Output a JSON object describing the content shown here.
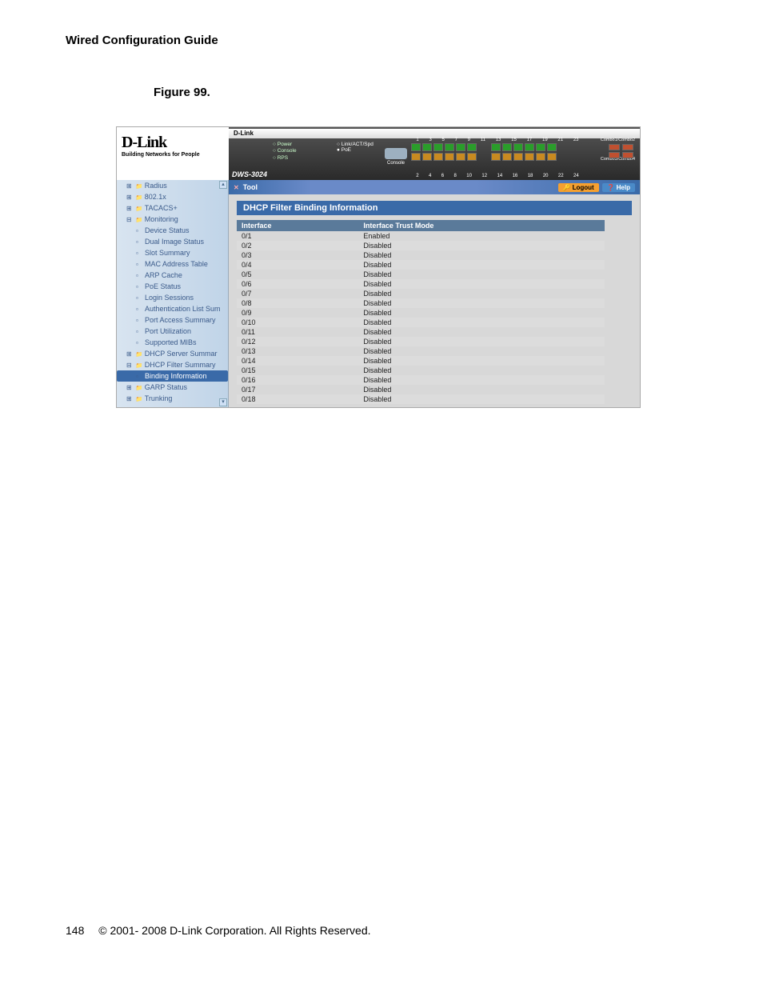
{
  "doc": {
    "header": "Wired Configuration Guide",
    "figure_caption": "Figure 99.",
    "page_number": "148",
    "copyright": "© 2001- 2008 D-Link Corporation. All Rights Reserved."
  },
  "logo": {
    "brand": "D-Link",
    "tagline": "Building Networks for People"
  },
  "device": {
    "brand_strip": "D-Link",
    "model": "DWS-3024",
    "leds": [
      "Power",
      "Console",
      "RPS"
    ],
    "link_label": "Link/ACT/Spd",
    "poe_label": "PoE",
    "console_label": "Console",
    "port_top_nums": [
      "1",
      "3",
      "5",
      "7",
      "9",
      "11",
      "13",
      "15",
      "17",
      "19",
      "21",
      "23"
    ],
    "port_bottom_nums": [
      "2",
      "4",
      "6",
      "8",
      "10",
      "12",
      "14",
      "16",
      "18",
      "20",
      "22",
      "24"
    ],
    "combo_label1": "Combo1/Combo2",
    "combo_label2": "Combo3/Combo4",
    "port_status_top_g1": [
      "up",
      "up",
      "up",
      "up",
      "up",
      "up"
    ],
    "port_status_bot_g1": [
      "amber",
      "amber",
      "amber",
      "amber",
      "amber",
      "amber"
    ],
    "port_status_top_g2": [
      "up",
      "up",
      "up",
      "up",
      "up",
      "up"
    ],
    "port_status_bot_g2": [
      "amber",
      "amber",
      "amber",
      "amber",
      "amber",
      "amber"
    ]
  },
  "toolbar": {
    "tool_label": "Tool",
    "logout": "Logout",
    "help": "Help"
  },
  "sidebar": [
    {
      "lvl": 1,
      "label": "Radius",
      "icon": "folder",
      "pre": "plus"
    },
    {
      "lvl": 1,
      "label": "802.1x",
      "icon": "folder",
      "pre": "plus"
    },
    {
      "lvl": 1,
      "label": "TACACS+",
      "icon": "folder",
      "pre": "plus"
    },
    {
      "lvl": 1,
      "label": "Monitoring",
      "icon": "folder",
      "pre": "minus"
    },
    {
      "lvl": 2,
      "label": "Device Status",
      "icon": "doc"
    },
    {
      "lvl": 2,
      "label": "Dual Image Status",
      "icon": "doc"
    },
    {
      "lvl": 2,
      "label": "Slot Summary",
      "icon": "doc"
    },
    {
      "lvl": 2,
      "label": "MAC Address Table",
      "icon": "doc"
    },
    {
      "lvl": 2,
      "label": "ARP Cache",
      "icon": "doc"
    },
    {
      "lvl": 2,
      "label": "PoE Status",
      "icon": "doc"
    },
    {
      "lvl": 2,
      "label": "Login Sessions",
      "icon": "doc"
    },
    {
      "lvl": 2,
      "label": "Authentication List Sum",
      "icon": "doc"
    },
    {
      "lvl": 2,
      "label": "Port Access Summary",
      "icon": "doc"
    },
    {
      "lvl": 2,
      "label": "Port Utilization",
      "icon": "doc"
    },
    {
      "lvl": 2,
      "label": "Supported MIBs",
      "icon": "doc"
    },
    {
      "lvl": 1,
      "label": "DHCP Server Summar",
      "icon": "folder",
      "pre": "plus"
    },
    {
      "lvl": 1,
      "label": "DHCP Filter Summary",
      "icon": "folder",
      "pre": "minus"
    },
    {
      "lvl": 2,
      "label": "Binding Information",
      "icon": "doc",
      "selected": true
    },
    {
      "lvl": 1,
      "label": "GARP Status",
      "icon": "folder",
      "pre": "plus"
    },
    {
      "lvl": 1,
      "label": "Trunking",
      "icon": "folder",
      "pre": "plus"
    }
  ],
  "panel": {
    "title": "DHCP Filter Binding Information",
    "columns": [
      "Interface",
      "Interface Trust Mode"
    ],
    "rows": [
      {
        "iface": "0/1",
        "mode": "Enabled"
      },
      {
        "iface": "0/2",
        "mode": "Disabled"
      },
      {
        "iface": "0/3",
        "mode": "Disabled"
      },
      {
        "iface": "0/4",
        "mode": "Disabled"
      },
      {
        "iface": "0/5",
        "mode": "Disabled"
      },
      {
        "iface": "0/6",
        "mode": "Disabled"
      },
      {
        "iface": "0/7",
        "mode": "Disabled"
      },
      {
        "iface": "0/8",
        "mode": "Disabled"
      },
      {
        "iface": "0/9",
        "mode": "Disabled"
      },
      {
        "iface": "0/10",
        "mode": "Disabled"
      },
      {
        "iface": "0/11",
        "mode": "Disabled"
      },
      {
        "iface": "0/12",
        "mode": "Disabled"
      },
      {
        "iface": "0/13",
        "mode": "Disabled"
      },
      {
        "iface": "0/14",
        "mode": "Disabled"
      },
      {
        "iface": "0/15",
        "mode": "Disabled"
      },
      {
        "iface": "0/16",
        "mode": "Disabled"
      },
      {
        "iface": "0/17",
        "mode": "Disabled"
      },
      {
        "iface": "0/18",
        "mode": "Disabled"
      }
    ]
  }
}
